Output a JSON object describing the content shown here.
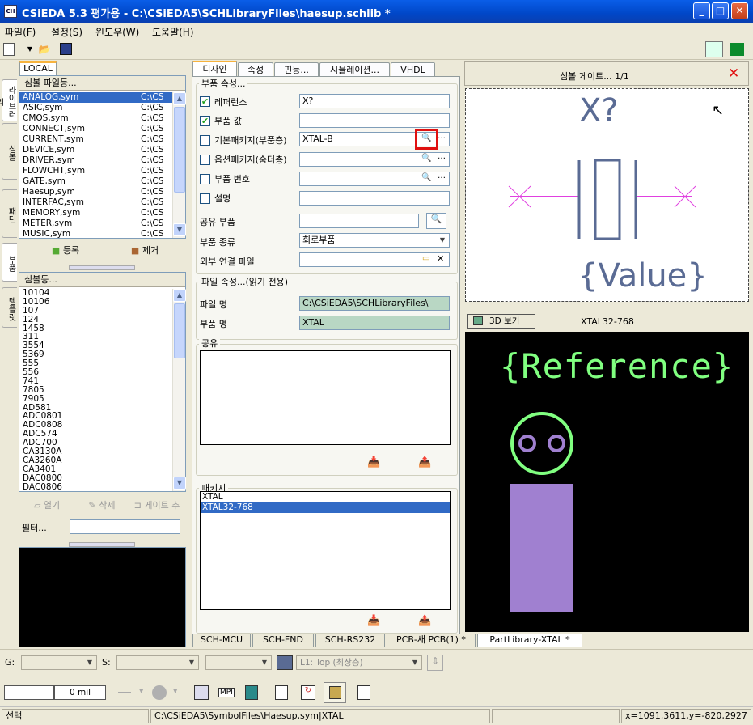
{
  "window": {
    "title": "CSiEDA 5.3 평가용 - C:\\CSiEDA5\\SCHLibraryFiles\\haesup.schlib *",
    "app_icon": "CH"
  },
  "menu": [
    "파일(F)",
    "설정(S)",
    "윈도우(W)",
    "도움말(H)"
  ],
  "left": {
    "local_tab": "LOCAL",
    "file_list_header": "심볼 파일등...",
    "files": [
      {
        "name": "ANALOG,sym",
        "path": "C:\\CS"
      },
      {
        "name": "ASIC,sym",
        "path": "C:\\CS"
      },
      {
        "name": "CMOS,sym",
        "path": "C:\\CS"
      },
      {
        "name": "CONNECT,sym",
        "path": "C:\\CS"
      },
      {
        "name": "CURRENT,sym",
        "path": "C:\\CS"
      },
      {
        "name": "DEVICE,sym",
        "path": "C:\\CS"
      },
      {
        "name": "DRIVER,sym",
        "path": "C:\\CS"
      },
      {
        "name": "FLOWCHT,sym",
        "path": "C:\\CS"
      },
      {
        "name": "GATE,sym",
        "path": "C:\\CS"
      },
      {
        "name": "Haesup,sym",
        "path": "C:\\CS"
      },
      {
        "name": "INTERFAC,sym",
        "path": "C:\\CS"
      },
      {
        "name": "MEMORY,sym",
        "path": "C:\\CS"
      },
      {
        "name": "METER,sym",
        "path": "C:\\CS"
      },
      {
        "name": "MUSIC,sym",
        "path": "C:\\CS"
      }
    ],
    "register_label": "등록",
    "remove_label": "제거",
    "symbol_header": "심볼등...",
    "symbols": [
      "10104",
      "10106",
      "107",
      "124",
      "1458",
      "311",
      "3554",
      "5369",
      "555",
      "556",
      "741",
      "7805",
      "7905",
      "AD581",
      "ADC0801",
      "ADC0808",
      "ADC574",
      "ADC700",
      "CA3130A",
      "CA3260A",
      "CA3401",
      "DAC0800",
      "DAC0806"
    ],
    "open_label": "열기",
    "delete_label": "삭제",
    "gate_add_label": "게이트 추",
    "filter_label": "필터...",
    "side_tabs": [
      "라이브러리",
      "심볼",
      "패턴",
      "부품",
      "템플릿"
    ]
  },
  "center": {
    "tabs": [
      "디자인",
      "속성",
      "핀등...",
      "시뮬레이션...",
      "VHDL"
    ],
    "part_props_title": "부품 속성...",
    "reference_label": "레퍼런스",
    "reference_value": "X?",
    "value_label": "부품 값",
    "value_value": "",
    "default_pkg_label": "기본패키지(부품층)",
    "default_pkg_value": "XTAL-B",
    "option_pkg_label": "옵션패키지(숨더층)",
    "part_number_label": "부품 번호",
    "desc_label": "설명",
    "shared_part_label": "공유 부품",
    "part_type_label": "부품 종류",
    "part_type_value": "회로부품",
    "ext_link_label": "외부 연결 파일",
    "file_props_title": "파일 속성...(읽기 전용)",
    "filename_label": "파일 명",
    "filename_value": "C:\\CSiEDA5\\SCHLibraryFiles\\",
    "partname_label": "부품 명",
    "partname_value": "XTAL",
    "share_title": "공유",
    "package_title": "패키지",
    "packages": [
      "XTAL",
      "XTAL32-768"
    ],
    "reference_checked": "✔",
    "value_checked": "✔"
  },
  "right": {
    "gate_title": "심볼 게이트... 1/1",
    "symbol_ref": "X?",
    "symbol_value": "{Value}",
    "view3d_label": "3D 보기",
    "footprint_name": "XTAL32-768",
    "footprint_ref": "{Reference}"
  },
  "bottom_tabs": [
    "SCH-MCU",
    "SCH-FND",
    "SCH-RS232",
    "PCB-새 PCB(1) *",
    "PartLibrary-XTAL *"
  ],
  "toolbar2": {
    "g_label": "G:",
    "s_label": "S:",
    "layer_value": "L1: Top (최상층)",
    "width_value": "0 mil",
    "mpi_label": "MPI"
  },
  "status": {
    "mode": "선택",
    "path": "C:\\CSiEDA5\\SymbolFiles\\Haesup,sym|XTAL",
    "coords": "x=1091,3611,y=-820,2927"
  },
  "colors": {
    "titlebar": "#0a5ee8",
    "selection": "#316ac5",
    "pin": "#e040e0",
    "symbol": "#5a6b94",
    "silkscreen": "#80ff80",
    "pad": "#a080d0"
  }
}
